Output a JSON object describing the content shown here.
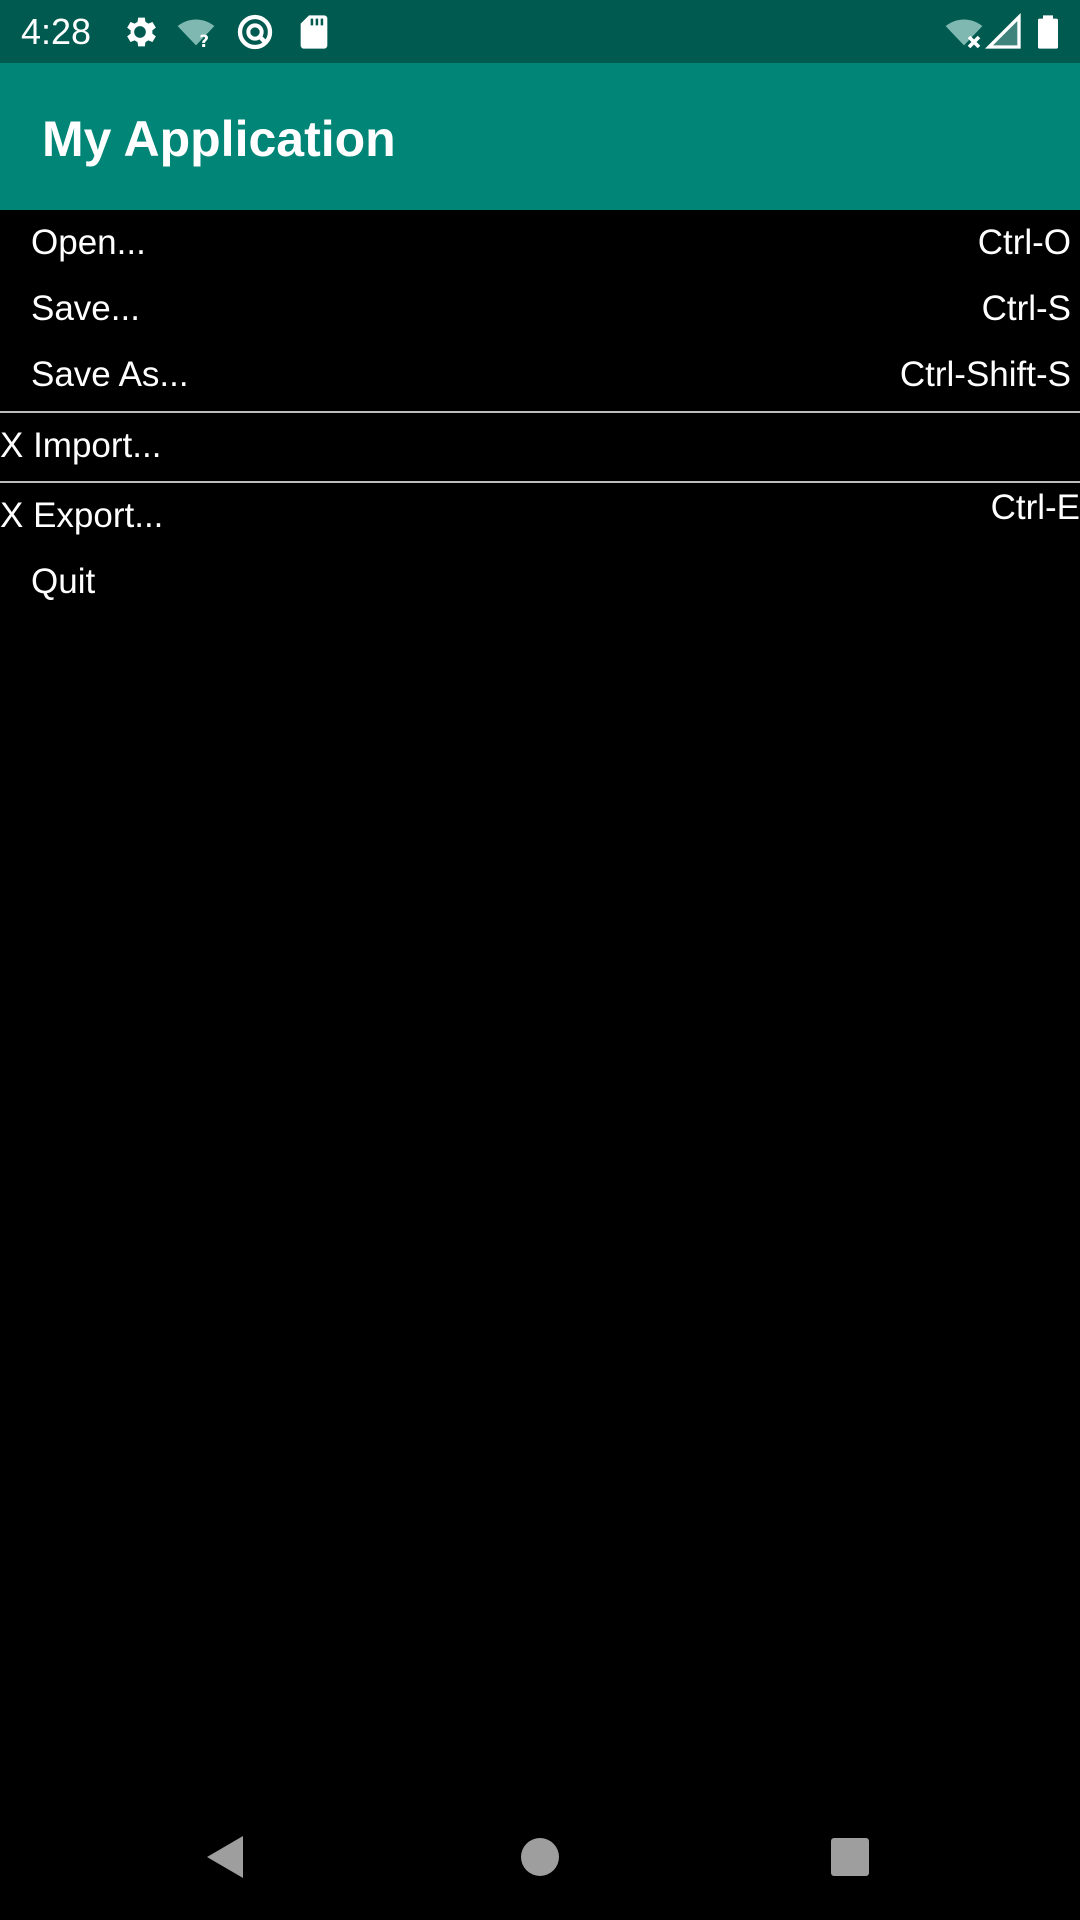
{
  "status_bar": {
    "time": "4:28",
    "background": "#005a50",
    "left_icons": [
      "settings-gear-icon",
      "wifi-unknown-icon",
      "data-saver-icon",
      "sd-card-icon"
    ],
    "right_icons": [
      "wifi-off-icon",
      "cell-signal-icon",
      "battery-icon"
    ]
  },
  "app_bar": {
    "title": "My Application",
    "background": "#008577"
  },
  "menu": {
    "items": [
      {
        "label": "Open...",
        "shortcut": "Ctrl-O"
      },
      {
        "label": "Save...",
        "shortcut": "Ctrl-S"
      },
      {
        "label": "Save As...",
        "shortcut": "Ctrl-Shift-S"
      },
      {
        "label": "X Import...",
        "shortcut": ""
      },
      {
        "label": "X Export...",
        "shortcut": "Ctrl-E"
      },
      {
        "label": "Quit",
        "shortcut": ""
      }
    ],
    "divider_color": "#bdbdbd"
  },
  "nav_bar": {
    "buttons": [
      "back-icon",
      "home-icon",
      "recents-icon"
    ]
  }
}
